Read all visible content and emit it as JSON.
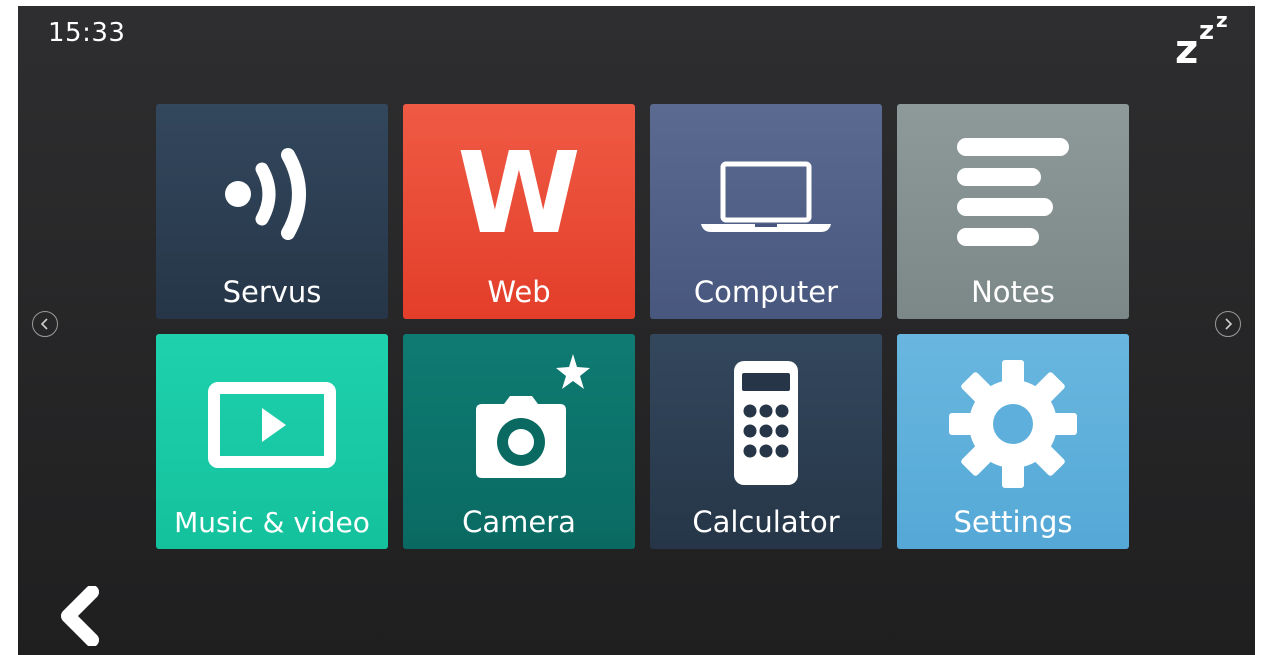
{
  "status_bar": {
    "time": "15:33",
    "sleep_icon": "zzz-sleep-icon",
    "sleep_letters": [
      "z",
      "z",
      "z"
    ]
  },
  "tiles": [
    {
      "label": "Servus",
      "icon": "servus-signal-icon",
      "color": "#2b3d51"
    },
    {
      "label": "Web",
      "icon": "web-w-icon",
      "icon_text": "W",
      "color": "#e84a35"
    },
    {
      "label": "Computer",
      "icon": "laptop-icon",
      "color": "#505f86"
    },
    {
      "label": "Notes",
      "icon": "notes-lines-icon",
      "color": "#848f8f"
    },
    {
      "label": "Music & video",
      "icon": "play-video-icon",
      "color": "#19c9a6"
    },
    {
      "label": "Camera",
      "icon": "camera-star-icon",
      "color": "#0c7168"
    },
    {
      "label": "Calculator",
      "icon": "calculator-icon",
      "color": "#2b3d51"
    },
    {
      "label": "Settings",
      "icon": "gear-icon",
      "color": "#5eafdb"
    }
  ],
  "navigation": {
    "prev_icon": "chevron-left-circle-icon",
    "next_icon": "chevron-right-circle-icon",
    "back_icon": "back-arrow-icon"
  },
  "colors": {
    "background": "#262627",
    "text": "#ffffff"
  }
}
